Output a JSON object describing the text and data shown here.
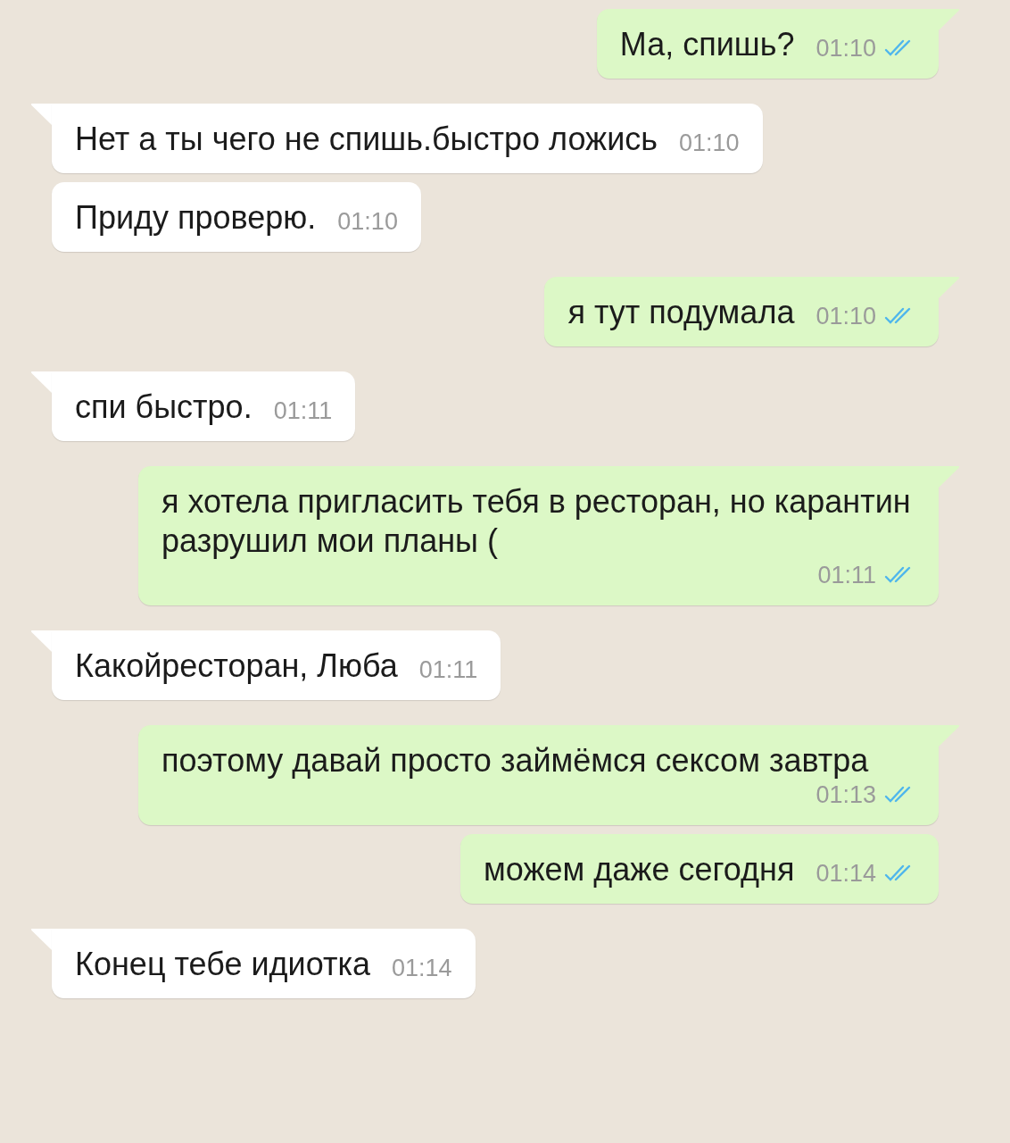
{
  "messages": [
    {
      "kind": "outgoing",
      "text": "Ма, спишь?",
      "time": "01:10",
      "read": true
    },
    {
      "kind": "incoming",
      "text": "Нет а ты чего не спишь.быстро ложись",
      "time": "01:10"
    },
    {
      "kind": "incoming",
      "text": "Приду проверю.",
      "time": "01:10"
    },
    {
      "kind": "outgoing",
      "text": "я тут подумала",
      "time": "01:10",
      "read": true
    },
    {
      "kind": "incoming",
      "text": "спи быстро.",
      "time": "01:11"
    },
    {
      "kind": "outgoing",
      "text": "я хотела пригласить тебя в ресторан, но карантин разрушил мои планы (",
      "time": "01:11",
      "read": true
    },
    {
      "kind": "incoming",
      "text": "Какойресторан, Люба",
      "time": "01:11"
    },
    {
      "kind": "outgoing",
      "text": "поэтому давай просто займёмся сексом завтра",
      "time": "01:13",
      "read": true
    },
    {
      "kind": "outgoing",
      "text": "можем даже сегодня",
      "time": "01:14",
      "read": true
    },
    {
      "kind": "incoming",
      "text": "Конец тебе идиотка",
      "time": "01:14"
    }
  ]
}
